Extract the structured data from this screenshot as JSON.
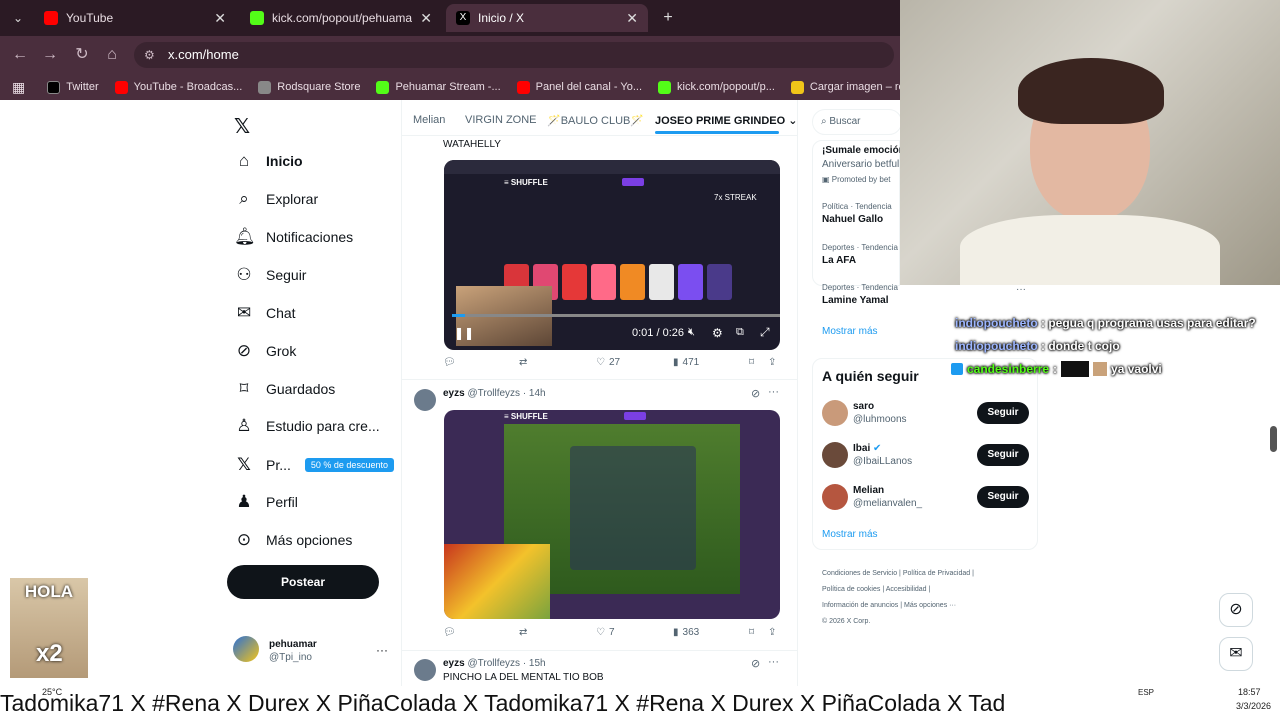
{
  "browser": {
    "tabs": [
      {
        "label": "YouTube",
        "color": "#ff0000"
      },
      {
        "label": "kick.com/popout/pehuamar/ch",
        "color": "#53fc18"
      },
      {
        "label": "Inicio / X",
        "color": "#000000"
      }
    ],
    "url": "x.com/home",
    "bookmarks": [
      {
        "label": "Twitter",
        "color": "#000000"
      },
      {
        "label": "YouTube - Broadcas...",
        "color": "#ff0000"
      },
      {
        "label": "Rodsquare Store",
        "color": "#888888"
      },
      {
        "label": "Pehuamar Stream -...",
        "color": "#53fc18"
      },
      {
        "label": "Panel del canal - Yo...",
        "color": "#ff0000"
      },
      {
        "label": "kick.com/popout/p...",
        "color": "#53fc18"
      },
      {
        "label": "Cargar imagen – re...",
        "color": "#f0c419"
      }
    ]
  },
  "nav": {
    "items": [
      {
        "label": "Inicio",
        "icon": "home-icon",
        "glyph": "⌂"
      },
      {
        "label": "Explorar",
        "icon": "search-icon",
        "glyph": "⌕"
      },
      {
        "label": "Notificaciones",
        "icon": "bell-icon",
        "glyph": "🔔"
      },
      {
        "label": "Seguir",
        "icon": "add-user-icon",
        "glyph": "👤"
      },
      {
        "label": "Chat",
        "icon": "mail-icon",
        "glyph": "✉"
      },
      {
        "label": "Grok",
        "icon": "grok-icon",
        "glyph": "⊘"
      },
      {
        "label": "Guardados",
        "icon": "bookmark-icon",
        "glyph": "🔖"
      },
      {
        "label": "Estudio para cre...",
        "icon": "studio-icon",
        "glyph": "♙"
      },
      {
        "label": "Pr...",
        "icon": "x-premium-icon",
        "glyph": "𝕏"
      },
      {
        "label": "Perfil",
        "icon": "profile-icon",
        "glyph": "👤"
      },
      {
        "label": "Más opciones",
        "icon": "more-icon",
        "glyph": "⋯"
      }
    ],
    "premium_badge": "50 % de descuento",
    "post_button": "Postear",
    "account": {
      "name": "pehuamar",
      "handle": "@Tpi_ino"
    }
  },
  "feed": {
    "tabs": [
      "Melian",
      "VIRGIN ZONE",
      "🪄BAULO CLUB🪄",
      "JOSEO PRIME GRINDEO"
    ],
    "post1": {
      "text": "WATAHELLY",
      "video_time": "0:01 / 0:26",
      "overlay_streak": "7x STREAK",
      "likes": "27",
      "views": "471"
    },
    "post2": {
      "author": "eyzs",
      "handle": "@Trollfeyzs",
      "time": "· 14h",
      "likes": "7",
      "views": "363"
    },
    "post3": {
      "author": "eyzs",
      "handle": "@Trollfeyzs",
      "time": "· 15h",
      "text": "PINCHO LA DEL MENTAL TIO BOB"
    }
  },
  "sidebar": {
    "search_placeholder": "Buscar",
    "promo": {
      "title": "¡Sumale emoción",
      "subtitle": "Aniversario betful",
      "promoted": "Promoted by bet"
    },
    "trends": [
      {
        "context": "Política · Tendencia",
        "name": "Nahuel Gallo"
      },
      {
        "context": "Deportes · Tendencia",
        "name": "La AFA"
      },
      {
        "context": "Deportes · Tendencia",
        "name": "Lamine Yamal"
      }
    ],
    "show_more": "Mostrar más",
    "who_to_follow": {
      "title": "A quién seguir",
      "users": [
        {
          "name": "saro",
          "handle": "@luhmoons",
          "verified": false
        },
        {
          "name": "Ibai",
          "handle": "@IbaiLLanos",
          "verified": true
        },
        {
          "name": "Melian",
          "handle": "@melianvalen_",
          "verified": false
        }
      ],
      "follow_label": "Seguir",
      "show_more": "Mostrar más"
    },
    "footer": [
      "Condiciones de Servicio",
      "Política de Privacidad",
      "Política de cookies",
      "Accesibilidad",
      "Información de anuncios",
      "Más opciones ···",
      "© 2026 X Corp."
    ]
  },
  "overlay": {
    "chat": [
      {
        "user": "indiopoucheto",
        "sep": " : ",
        "msg": "pegua q programa usas para editar?"
      },
      {
        "user": "indiopoucheto",
        "sep": " : ",
        "msg": "donde t cojo"
      },
      {
        "user": "candesinberre",
        "sep": " : ",
        "msg": "ya vaolvi"
      }
    ],
    "hola_sticker": "HOLA",
    "x2": "x2",
    "ticker": "Tadomika71  X  #Rena  X  Durex  X  PiñaColada  X  Tadomika71  X  #Rena  X  Durex  X  PiñaColada  X  Tad",
    "weather": "25°C",
    "clock_time": "18:57",
    "clock_date": "3/3/2026",
    "lang": "ESP"
  }
}
